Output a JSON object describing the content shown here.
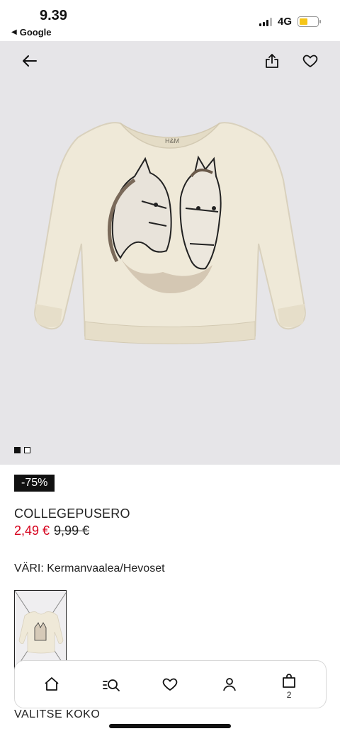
{
  "status_bar": {
    "time": "9.39",
    "back_app": "Google",
    "network": "4G",
    "battery_level": 0.45
  },
  "hero": {
    "icons": {
      "back": "arrow-left-icon",
      "share": "share-icon",
      "favorite": "heart-outline-icon"
    },
    "pager": {
      "count": 2,
      "active_index": 0
    },
    "brand_tag": "H&M"
  },
  "product": {
    "discount_badge": "-75%",
    "title": "COLLEGEPUSERO",
    "price_sale": "2,49 €",
    "price_original": "9,99 €",
    "color_text": "VÄRI: Kermanvaalea/Hevoset",
    "size_label_peek": "VALITSE KOKO"
  },
  "bottom_nav": {
    "items": [
      "home-icon",
      "search-icon",
      "heart-icon",
      "account-icon",
      "bag-icon"
    ],
    "cart_count": "2"
  },
  "colors": {
    "sale_red": "#d6001c",
    "badge_bg": "#111111",
    "hero_bg": "#e6e5e8",
    "sweater": "#efe9d8"
  }
}
